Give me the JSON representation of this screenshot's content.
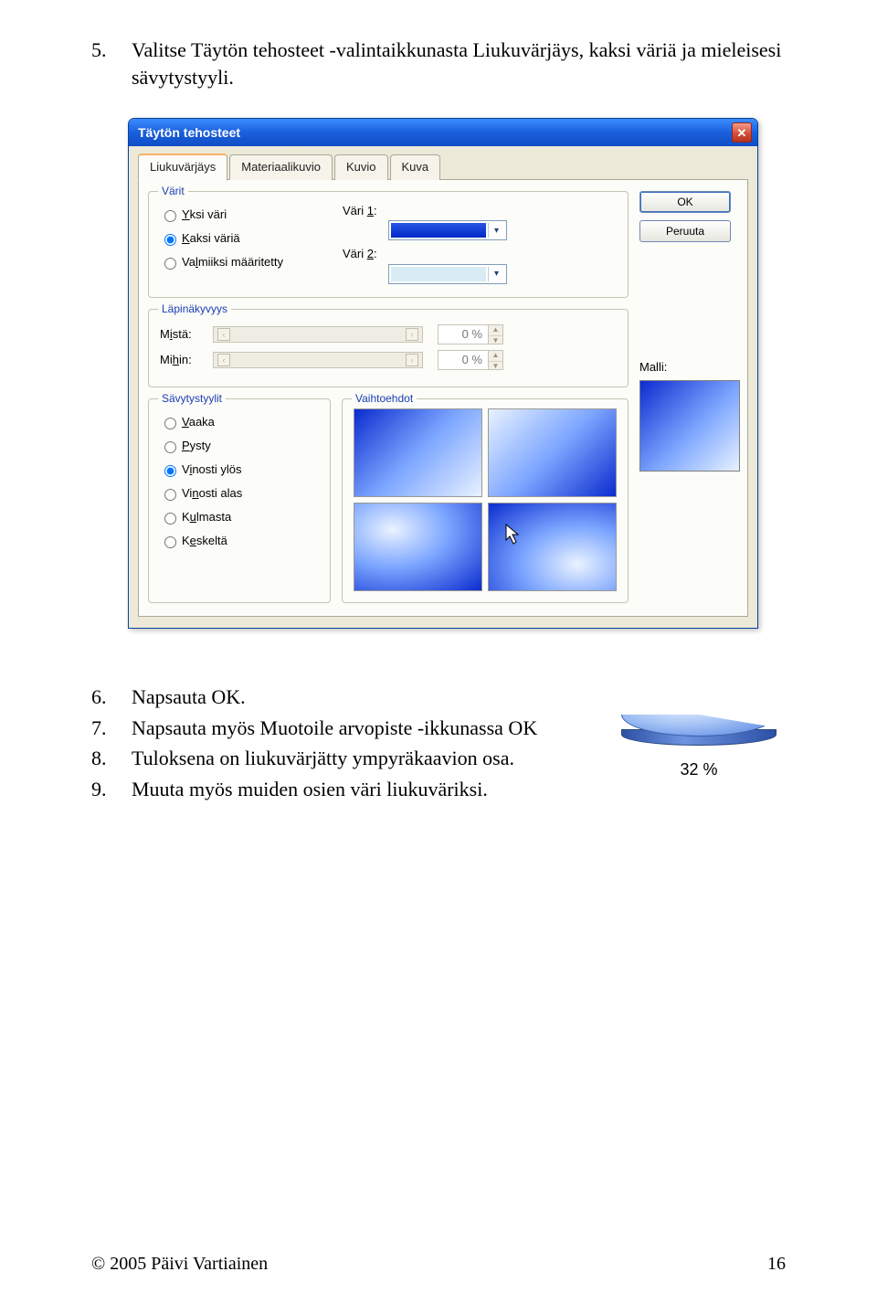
{
  "instructions1": {
    "num": "5.",
    "text": "Valitse Täytön tehosteet -valintaikkunasta Liukuvärjäys, kaksi väriä ja mieleisesi sävytystyyli."
  },
  "dialog": {
    "title": "Täytön tehosteet",
    "tabs": [
      "Liukuvärjäys",
      "Materiaalikuvio",
      "Kuvio",
      "Kuva"
    ],
    "ok": "OK",
    "cancel": "Peruuta",
    "groups": {
      "colors": {
        "legend": "Värit",
        "opt_one": "Yksi väri",
        "opt_two": "Kaksi väriä",
        "opt_preset": "Valmiiksi määritetty",
        "color1_label": "Väri 1:",
        "color2_label": "Väri 2:"
      },
      "transparency": {
        "legend": "Läpinäkyvyys",
        "from": "Mistä:",
        "to": "Mihin:",
        "value": "0 %"
      },
      "shades": {
        "legend": "Sävytystyylit",
        "opts": [
          "Vaaka",
          "Pysty",
          "Vinosti ylös",
          "Vinosti alas",
          "Kulmasta",
          "Keskeltä"
        ]
      },
      "variants": {
        "legend": "Vaihtoehdot"
      },
      "sample": {
        "label": "Malli:"
      }
    }
  },
  "instructions2": [
    {
      "num": "6.",
      "text": "Napsauta OK."
    },
    {
      "num": "7.",
      "text": "Napsauta myös Muotoile arvopiste -ikkunassa OK"
    },
    {
      "num": "8.",
      "text": "Tuloksena on liukuvärjätty ympyräkaavion osa."
    },
    {
      "num": "9.",
      "text": "Muuta myös muiden osien väri liukuväriksi."
    }
  ],
  "pie_label": "32 %",
  "footer": {
    "copyright": "© 2005 Päivi Vartiainen",
    "page": "16"
  }
}
